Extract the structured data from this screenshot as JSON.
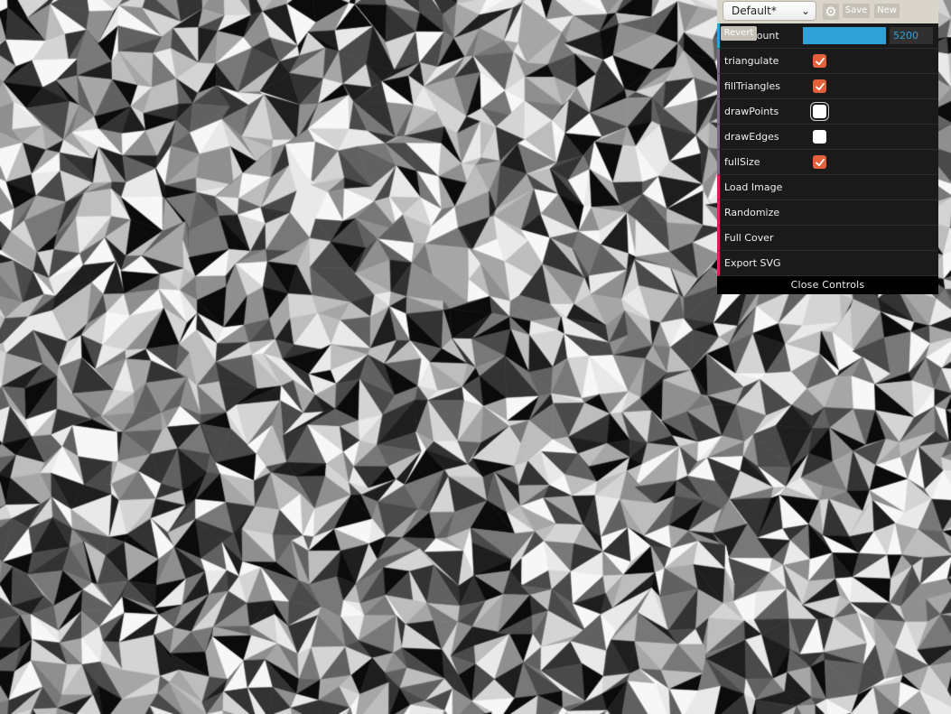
{
  "canvas": {
    "description_palette": [
      "#0b0b0b",
      "#1e1e1e",
      "#333333",
      "#4a4a4a",
      "#616161",
      "#787878",
      "#8f8f8f",
      "#a6a6a6",
      "#bdbdbd",
      "#d4d4d4",
      "#e9e9e9",
      "#f7f7f7"
    ],
    "edge_color": "#ffffff"
  },
  "gui": {
    "preset": {
      "selected": "Default*"
    },
    "toolbar": {
      "gear_icon": "gear-icon",
      "save_label": "Save",
      "new_label": "New"
    },
    "count": {
      "revert_label": "Revert",
      "label": "pointCount",
      "value": "5200",
      "fill_fraction": 1.0
    },
    "booleans": [
      {
        "key": "triangulate",
        "label": "triangulate",
        "checked": true
      },
      {
        "key": "fillTriangles",
        "label": "fillTriangles",
        "checked": true
      },
      {
        "key": "drawPoints",
        "label": "drawPoints",
        "checked": false,
        "focused": true
      },
      {
        "key": "drawEdges",
        "label": "drawEdges",
        "checked": false
      },
      {
        "key": "fullSize",
        "label": "fullSize",
        "checked": true
      }
    ],
    "functions": [
      {
        "key": "load-image",
        "label": "Load Image"
      },
      {
        "key": "randomize",
        "label": "Randomize"
      },
      {
        "key": "full-cover",
        "label": "Full Cover"
      },
      {
        "key": "export-svg",
        "label": "Export SVG"
      }
    ],
    "close_label": "Close Controls",
    "colors": {
      "number_accent": "#2fa1d6",
      "boolean_accent": "#806787",
      "function_accent": "#e61d5f",
      "checkbox_checked": "#e2613a",
      "panel_bg": "#1a1a1a",
      "save_row_bg": "#dad5cb"
    }
  }
}
